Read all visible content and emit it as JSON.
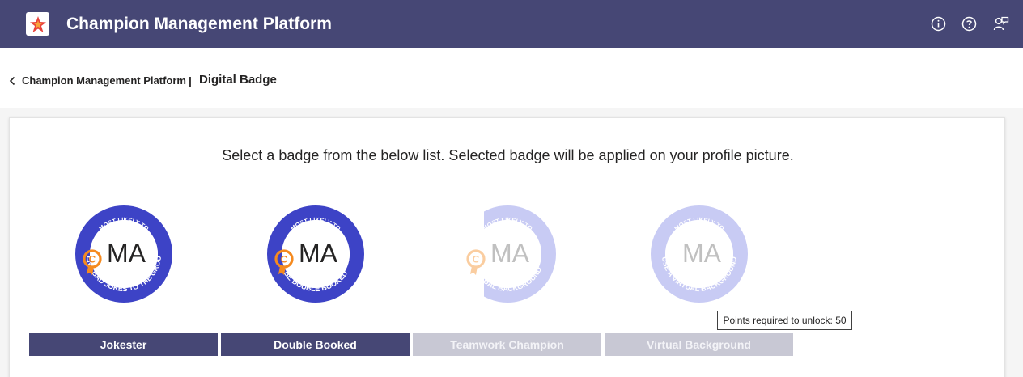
{
  "header": {
    "title": "Champion Management Platform",
    "icons": [
      "info-icon",
      "help-icon",
      "feedback-icon"
    ]
  },
  "breadcrumb": {
    "parent": "Champion Management Platform",
    "separator": "|",
    "current": "Digital Badge"
  },
  "main": {
    "instructions": "Select a badge from the below list. Selected badge will be applied on your profile picture.",
    "badges": [
      {
        "label": "Jokester",
        "initials": "MA",
        "ring_top": "MOST LIKELY TO",
        "ring_bottom": "SEND BAD JOKES TO THE GROUP",
        "locked": false
      },
      {
        "label": "Double Booked",
        "initials": "MA",
        "ring_top": "MOST LIKELY TO",
        "ring_bottom": "BE DOUBLE BOOKED",
        "locked": false
      },
      {
        "label": "Teamwork Champion",
        "initials": "MA",
        "ring_top": "MOST LIKELY TO",
        "ring_bottom": "VIRTUAL BACKGROUND",
        "locked": true
      },
      {
        "label": "Virtual Background",
        "initials": "MA",
        "ring_top": "MOST LIKELY TO",
        "ring_bottom": "USE A VIRTUAL BACKGROUND",
        "locked": true
      }
    ],
    "tooltip": "Points required to unlock: 50"
  },
  "colors": {
    "header_bg": "#464775",
    "badge_ring": "#3d43c6",
    "button_active": "#464775",
    "button_locked": "#c8c8d4",
    "medal_orange": "#f58a1f"
  }
}
